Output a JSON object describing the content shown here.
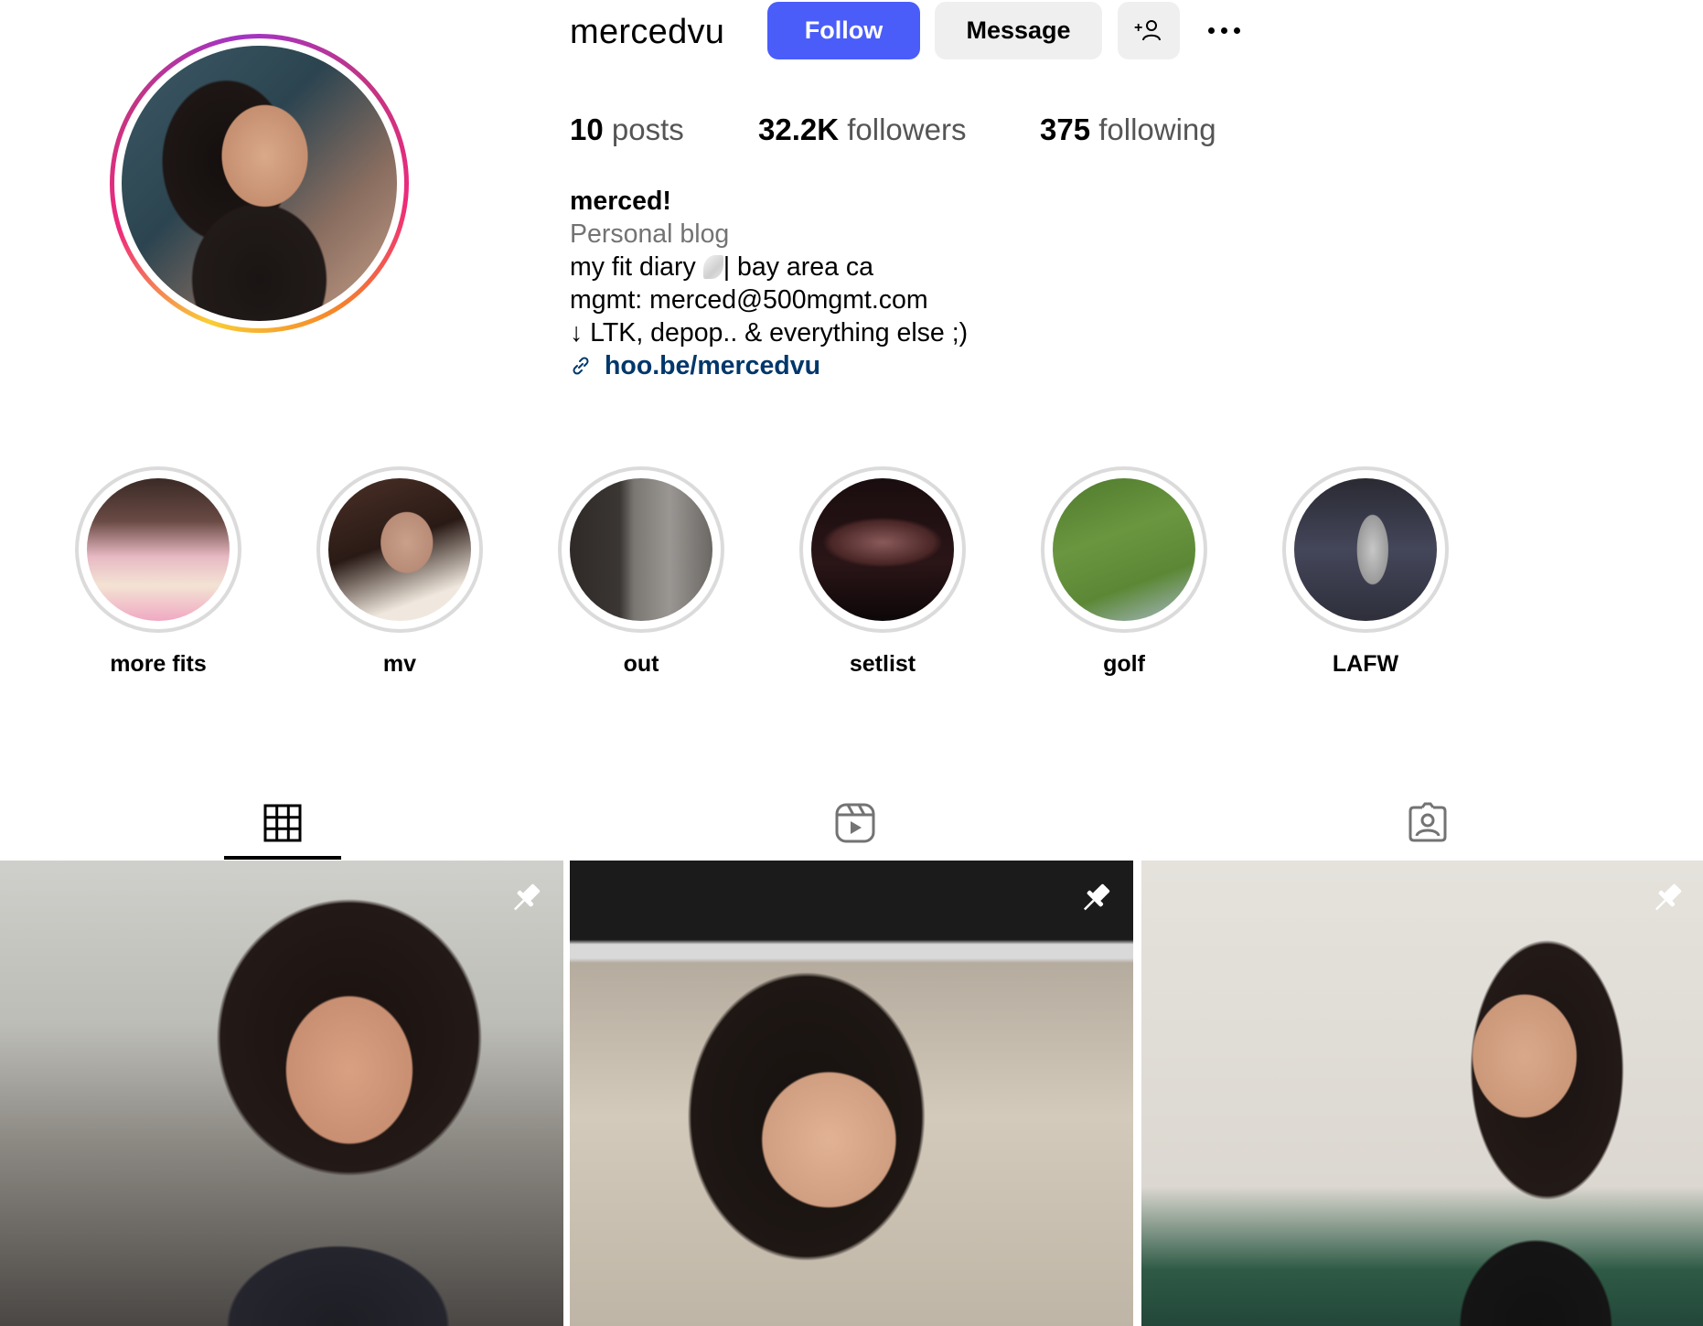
{
  "profile": {
    "username": "mercedvu",
    "follow_label": "Follow",
    "message_label": "Message",
    "suggest_icon": "add-person-icon",
    "more_icon": "more-options-icon"
  },
  "stats": {
    "posts_count": "10",
    "posts_label": "posts",
    "followers_count": "32.2K",
    "followers_label": "followers",
    "following_count": "375",
    "following_label": "following"
  },
  "bio": {
    "display_name": "merced!",
    "category": "Personal blog",
    "line1_a": "my fit diary ",
    "line1_b": "| bay area ca",
    "line2": "mgmt: merced@500mgmt.com",
    "line3": "↓ LTK, depop.. & everything else ;)",
    "link": "hoo.be/mercedvu"
  },
  "highlights": [
    {
      "label": "more fits"
    },
    {
      "label": "mv"
    },
    {
      "label": "out"
    },
    {
      "label": "setlist"
    },
    {
      "label": "golf"
    },
    {
      "label": "LAFW"
    }
  ],
  "tabs": [
    {
      "icon": "grid-icon",
      "active": true
    },
    {
      "icon": "reels-icon",
      "active": false
    },
    {
      "icon": "tagged-icon",
      "active": false
    }
  ],
  "posts": [
    {
      "pinned": true
    },
    {
      "pinned": true
    },
    {
      "pinned": true
    }
  ],
  "colors": {
    "accent": "#4a5df9",
    "link": "#00376b",
    "secondary_text": "#737373",
    "button_bg": "#efefef"
  }
}
